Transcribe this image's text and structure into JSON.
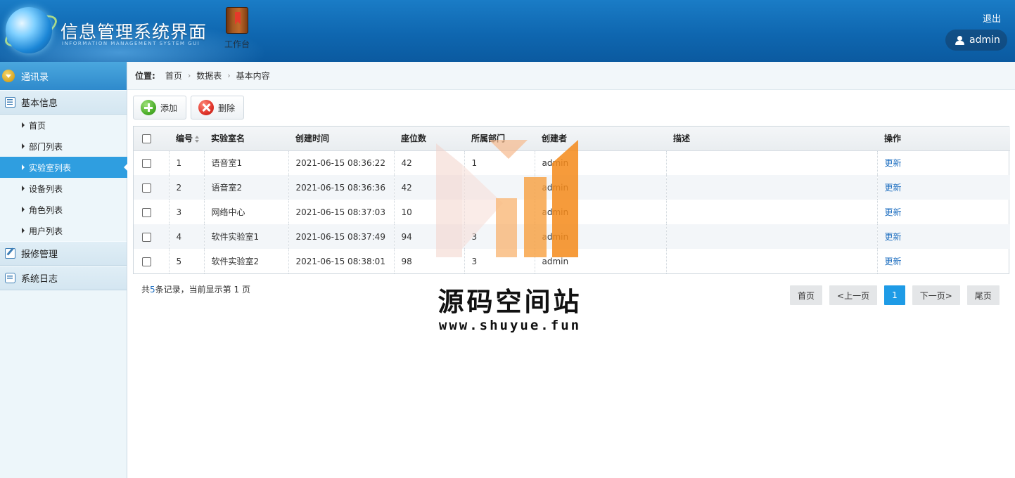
{
  "header": {
    "title": "信息管理系统界面",
    "subtitle": "INFORMATION MANAGEMENT SYSTEM GUI",
    "workbench_label": "工作台",
    "logout_label": "退出",
    "username": "admin",
    "icons": {
      "logo": "globe-logo-icon",
      "workbench": "book-icon",
      "user": "user-icon"
    }
  },
  "sidebar": {
    "header_label": "通讯录",
    "groups": [
      {
        "label": "基本信息",
        "icon": "list-icon",
        "items": [
          {
            "label": "首页"
          },
          {
            "label": "部门列表"
          },
          {
            "label": "实验室列表",
            "active": true
          },
          {
            "label": "设备列表"
          },
          {
            "label": "角色列表"
          },
          {
            "label": "用户列表"
          }
        ]
      },
      {
        "label": "报修管理",
        "icon": "edit-icon"
      },
      {
        "label": "系统日志",
        "icon": "chat-icon"
      }
    ]
  },
  "breadcrumb": {
    "label": "位置:",
    "items": [
      "首页",
      "数据表",
      "基本内容"
    ],
    "separator": "›"
  },
  "toolbar": {
    "add_label": "添加",
    "delete_label": "删除"
  },
  "table": {
    "headers": [
      "编号",
      "实验室名",
      "创建时间",
      "座位数",
      "所属部门",
      "创建者",
      "描述",
      "操作"
    ],
    "rows": [
      {
        "id": "1",
        "name": "语音室1",
        "created": "2021-06-15 08:36:22",
        "seats": "42",
        "dept": "1",
        "creator": "admin",
        "desc": "",
        "action": "更新"
      },
      {
        "id": "2",
        "name": "语音室2",
        "created": "2021-06-15 08:36:36",
        "seats": "42",
        "dept": "",
        "creator": "admin",
        "desc": "",
        "action": "更新"
      },
      {
        "id": "3",
        "name": "网络中心",
        "created": "2021-06-15 08:37:03",
        "seats": "10",
        "dept": "",
        "creator": "admin",
        "desc": "",
        "action": "更新"
      },
      {
        "id": "4",
        "name": "软件实验室1",
        "created": "2021-06-15 08:37:49",
        "seats": "94",
        "dept": "3",
        "creator": "admin",
        "desc": "",
        "action": "更新"
      },
      {
        "id": "5",
        "name": "软件实验室2",
        "created": "2021-06-15 08:38:01",
        "seats": "98",
        "dept": "3",
        "creator": "admin",
        "desc": "",
        "action": "更新"
      }
    ]
  },
  "footer": {
    "records_prefix": "共",
    "records_count": "5",
    "records_suffix": "条记录，当前显示第",
    "current_page": "1",
    "page_suffix": "页"
  },
  "pagination": {
    "first": "首页",
    "prev": "<上一页",
    "current": "1",
    "next": "下一页>",
    "last": "尾页"
  },
  "watermark": {
    "text": "源码空间站",
    "url": "www.shuyue.fun"
  },
  "colors": {
    "header_blue": "#0f67b0",
    "active_item": "#2f9ee0",
    "link": "#1f6fc0",
    "page_current": "#1e9be6"
  }
}
